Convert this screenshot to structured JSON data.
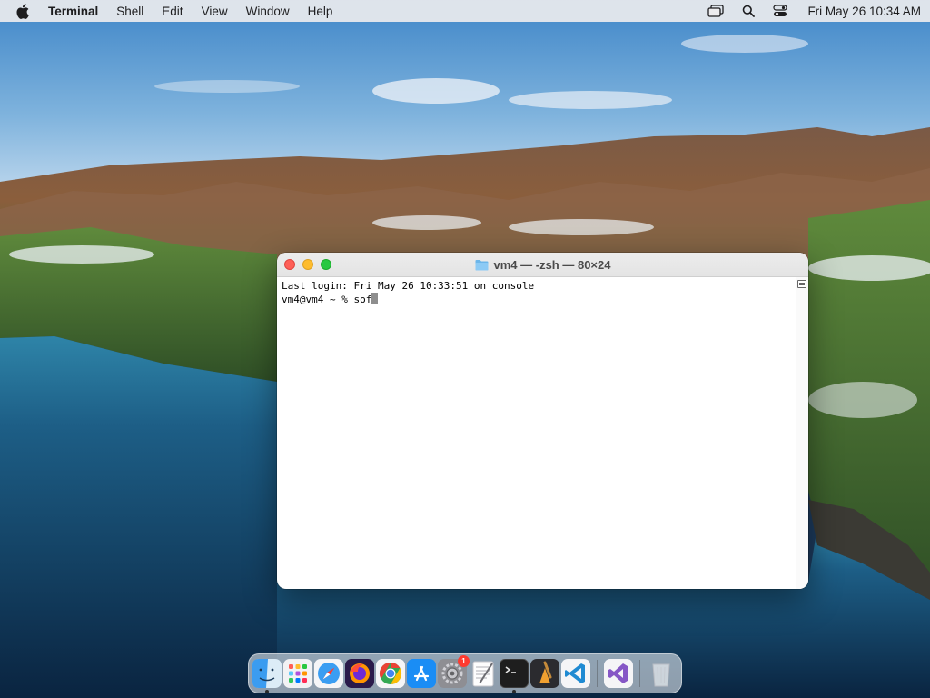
{
  "menubar": {
    "app_name": "Terminal",
    "menus": [
      "Shell",
      "Edit",
      "View",
      "Window",
      "Help"
    ],
    "clock": "Fri May 26  10:34 AM",
    "status_icons": [
      "screen-mirroring-icon",
      "spotlight-search-icon",
      "control-center-icon"
    ]
  },
  "terminal": {
    "title": "vm4 — -zsh — 80×24",
    "lines": [
      "Last login: Fri May 26 10:33:51 on console",
      "vm4@vm4 ~ % sof"
    ]
  },
  "dock": {
    "items": [
      {
        "name": "Finder",
        "icon": "finder-icon",
        "running": true
      },
      {
        "name": "Launchpad",
        "icon": "launchpad-icon",
        "running": false
      },
      {
        "name": "Safari",
        "icon": "safari-icon",
        "running": false
      },
      {
        "name": "Firefox",
        "icon": "firefox-icon",
        "running": false
      },
      {
        "name": "Google Chrome",
        "icon": "chrome-icon",
        "running": false
      },
      {
        "name": "App Store",
        "icon": "app-store-icon",
        "running": false
      },
      {
        "name": "System Preferences",
        "icon": "system-preferences-icon",
        "running": false,
        "badge": "1"
      },
      {
        "name": "TextEdit",
        "icon": "textedit-icon",
        "running": false
      },
      {
        "name": "Terminal",
        "icon": "terminal-icon",
        "running": true
      },
      {
        "name": "Instruments",
        "icon": "instruments-icon",
        "running": false
      },
      {
        "name": "Visual Studio Code",
        "icon": "vscode-icon",
        "running": false
      },
      {
        "name": "Visual Studio",
        "icon": "visual-studio-icon",
        "running": false
      },
      {
        "name": "Trash",
        "icon": "trash-icon",
        "running": false
      }
    ]
  },
  "colors": {
    "close": "#fe5f57",
    "minimize": "#febc2e",
    "zoom": "#28c840",
    "badge": "#ff3b30"
  }
}
